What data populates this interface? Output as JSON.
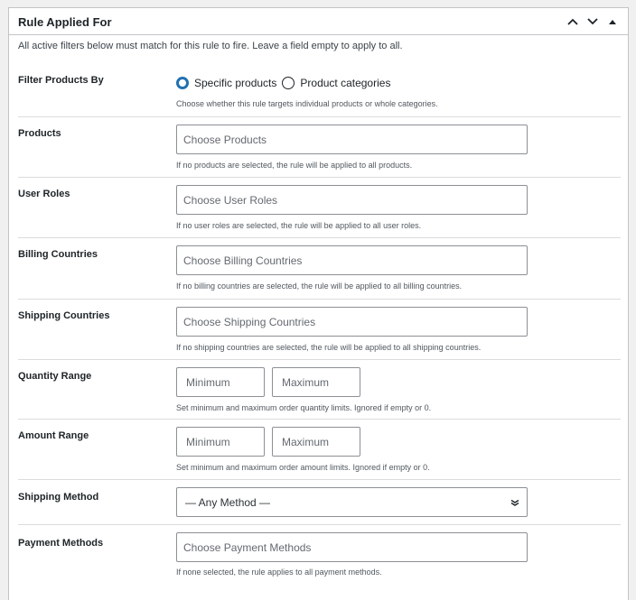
{
  "panel": {
    "title": "Rule Applied For",
    "intro": "All active filters below must match for this rule to fire. Leave a field empty to apply to all."
  },
  "fields": {
    "filter_by": {
      "label": "Filter Products By",
      "options": [
        "Specific products",
        "Product categories"
      ],
      "selected": "Specific products",
      "hint": "Choose whether this rule targets individual products or whole categories."
    },
    "products": {
      "label": "Products",
      "placeholder": "Choose Products",
      "hint": "If no products are selected, the rule will be applied to all products."
    },
    "user_roles": {
      "label": "User Roles",
      "placeholder": "Choose User Roles",
      "hint": "If no user roles are selected, the rule will be applied to all user roles."
    },
    "billing_countries": {
      "label": "Billing Countries",
      "placeholder": "Choose Billing Countries",
      "hint": "If no billing countries are selected, the rule will be applied to all billing countries."
    },
    "shipping_countries": {
      "label": "Shipping Countries",
      "placeholder": "Choose Shipping Countries",
      "hint": "If no shipping countries are selected, the rule will be applied to all shipping countries."
    },
    "quantity_range": {
      "label": "Quantity Range",
      "min_placeholder": "Minimum",
      "max_placeholder": "Maximum",
      "hint": "Set minimum and maximum order quantity limits. Ignored if empty or 0."
    },
    "amount_range": {
      "label": "Amount Range",
      "min_placeholder": "Minimum",
      "max_placeholder": "Maximum",
      "hint": "Set minimum and maximum order amount limits. Ignored if empty or 0."
    },
    "shipping_method": {
      "label": "Shipping Method",
      "value": "— Any Method —"
    },
    "payment_methods": {
      "label": "Payment Methods",
      "placeholder": "Choose Payment Methods",
      "hint": "If none selected, the rule applies to all payment methods."
    }
  },
  "colors": {
    "accent": "#2271b1",
    "border": "#c3c4c7",
    "divider": "#dcdcde"
  }
}
